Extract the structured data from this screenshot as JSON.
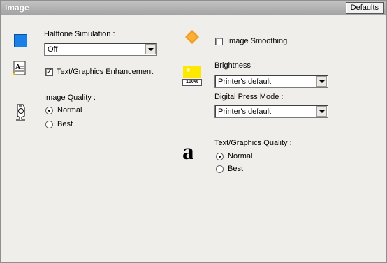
{
  "header": {
    "title": "Image",
    "defaults_label": "Defaults"
  },
  "halftone": {
    "label": "Halftone Simulation :",
    "value": "Off"
  },
  "text_graphics_enhancement": {
    "label": "Text/Graphics Enhancement",
    "checked": true
  },
  "image_quality": {
    "label": "Image Quality :",
    "options": [
      {
        "label": "Normal",
        "selected": true
      },
      {
        "label": "Best",
        "selected": false
      }
    ]
  },
  "image_smoothing": {
    "label": "Image Smoothing",
    "checked": false
  },
  "brightness": {
    "label": "Brightness :",
    "value": "Printer's default",
    "icon_text": "100%"
  },
  "digital_press_mode": {
    "label": "Digital Press Mode :",
    "value": "Printer's default"
  },
  "text_graphics_quality": {
    "label": "Text/Graphics Quality :",
    "icon_glyph": "a",
    "options": [
      {
        "label": "Normal",
        "selected": true
      },
      {
        "label": "Best",
        "selected": false
      }
    ]
  },
  "icons": [
    "blue-square-icon",
    "text-graphics-icon",
    "image-quality-icon",
    "diamond-icon",
    "brightness-icon",
    "letter-a-icon"
  ],
  "colors": {
    "title_bar": "#a9a9a9",
    "panel_bg": "#efeeea",
    "blue_square": "#1a7fe6",
    "diamond": "#f59a1b",
    "brightness": "#ffe800"
  }
}
